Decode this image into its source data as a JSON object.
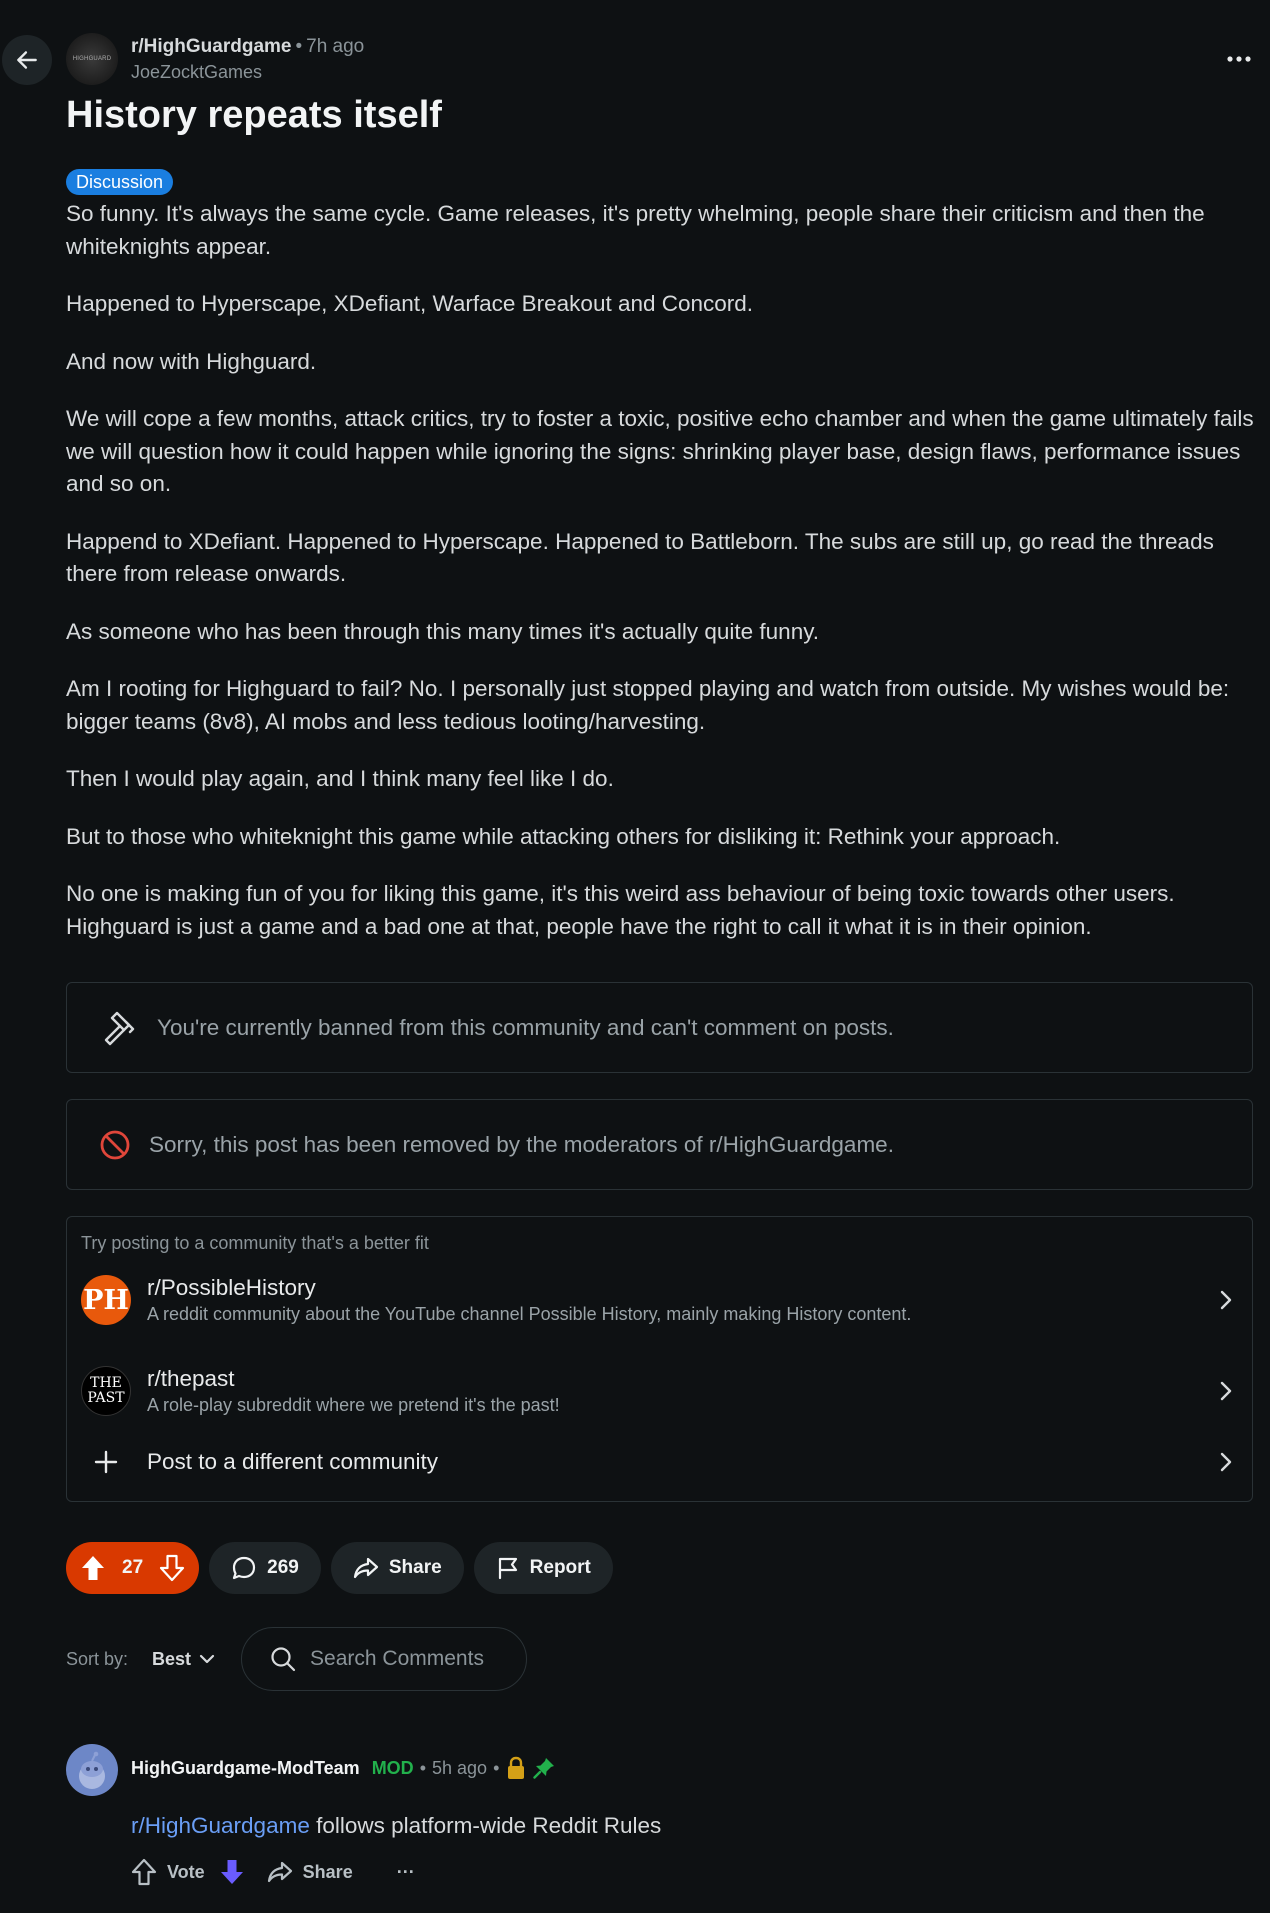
{
  "header": {
    "subreddit": "r/HighGuardgame",
    "separator": "•",
    "time": "7h ago",
    "author": "JoeZocktGames",
    "avatar_text": "HIGHGUARD"
  },
  "post": {
    "title": "History repeats itself",
    "flair": "Discussion",
    "paragraphs": [
      "So funny. It's always the same cycle. Game releases, it's pretty whelming, people share their criticism and then the whiteknights appear.",
      "Happened to Hyperscape, XDefiant, Warface Breakout and Concord.",
      "And now with Highguard.",
      "We will cope a few months, attack critics, try to foster a toxic, positive echo chamber and when the game ultimately fails we will question how it could happen while ignoring the signs: shrinking player base, design flaws, performance issues and so on.",
      "Happend to XDefiant. Happened to Hyperscape. Happened to Battleborn. The subs are still up, go read the threads there from release onwards.",
      "As someone who has been through this many times it's actually quite funny.",
      "Am I rooting for Highguard to fail? No. I personally just stopped playing and watch from outside. My wishes would be: bigger teams (8v8), AI mobs and less tedious looting/harvesting.",
      "Then I would play again, and I think many feel like I do.",
      "But to those who whiteknight this game while attacking others for disliking it: Rethink your approach.",
      "No one is making fun of you for liking this game, it's this weird ass behaviour of being toxic towards other users. Highguard is just a game and a bad one at that, people have the right to call it what it is in their opinion."
    ]
  },
  "notices": {
    "banned": "You're currently banned from this community and can't comment on posts.",
    "removed": "Sorry, this post has been removed by the moderators of r/HighGuardgame."
  },
  "suggest": {
    "header": "Try posting to a community that's a better fit",
    "communities": [
      {
        "name": "r/PossibleHistory",
        "desc": "A reddit community about the YouTube channel Possible History, mainly making History content.",
        "icon_text": "PH",
        "icon_color": "#e8590c"
      },
      {
        "name": "r/thepast",
        "desc": "A role-play subreddit where we pretend it's the past!",
        "icon_line1": "THE",
        "icon_line2": "PAST",
        "icon_color": "#000000"
      }
    ],
    "other": "Post to a different community"
  },
  "actions": {
    "votes": "27",
    "comments": "269",
    "share": "Share",
    "report": "Report"
  },
  "sort": {
    "label": "Sort by:",
    "value": "Best",
    "search_placeholder": "Search Comments"
  },
  "comment": {
    "author": "HighGuardgame-ModTeam",
    "mod": "MOD",
    "separator": "•",
    "time": "5h ago",
    "link": "r/HighGuardgame",
    "text": " follows platform-wide Reddit Rules",
    "vote": "Vote",
    "share": "Share",
    "more": "···"
  },
  "colors": {
    "background": "#0e1113",
    "upvote_orange": "#d93900",
    "flair_blue": "#1a7ee0",
    "mod_green": "#22b14c",
    "removed_red": "#e0463a",
    "link_blue": "#6a9ef5"
  }
}
